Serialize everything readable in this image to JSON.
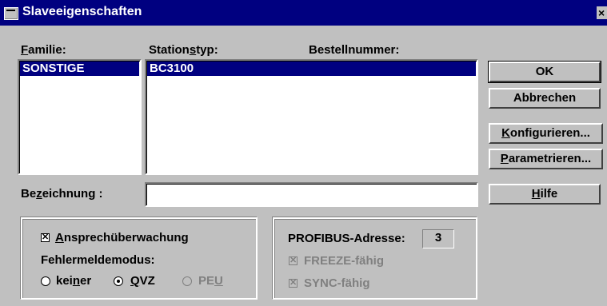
{
  "window": {
    "title": "Slaveeigenschaften",
    "close_glyph": "×"
  },
  "labels": {
    "familie": "Familie:",
    "stationstyp": "Stationstyp:",
    "bestellnummer": "Bestellnummer:",
    "bezeichnung": "Bezeichnung :"
  },
  "familie_list": {
    "items": [
      "SONSTIGE"
    ],
    "selected": "SONSTIGE"
  },
  "station_list": {
    "items": [
      {
        "typ": "BC3100",
        "bestellnummer": ""
      }
    ],
    "selected": "BC3100"
  },
  "bezeichnung_field": {
    "value": ""
  },
  "buttons": {
    "ok": "OK",
    "abbrechen": "Abbrechen",
    "konfigurieren": "Konfigurieren...",
    "parametrieren": "Parametrieren...",
    "hilfe": "Hilfe"
  },
  "monitoring": {
    "ansprech_label": "Ansprechüberwachung",
    "ansprech_checked": true,
    "fehler_label": "Fehlermeldemodus:",
    "radios": [
      {
        "label": "keiner",
        "checked": false,
        "enabled": true
      },
      {
        "label": "QVZ",
        "checked": true,
        "enabled": true
      },
      {
        "label": "PEU",
        "checked": false,
        "enabled": false
      }
    ]
  },
  "profibus": {
    "address_label": "PROFIBUS-Adresse:",
    "address_value": "3",
    "freeze_label": "FREEZE-fähig",
    "freeze_checked": true,
    "sync_label": "SYNC-fähig",
    "sync_checked": true
  }
}
